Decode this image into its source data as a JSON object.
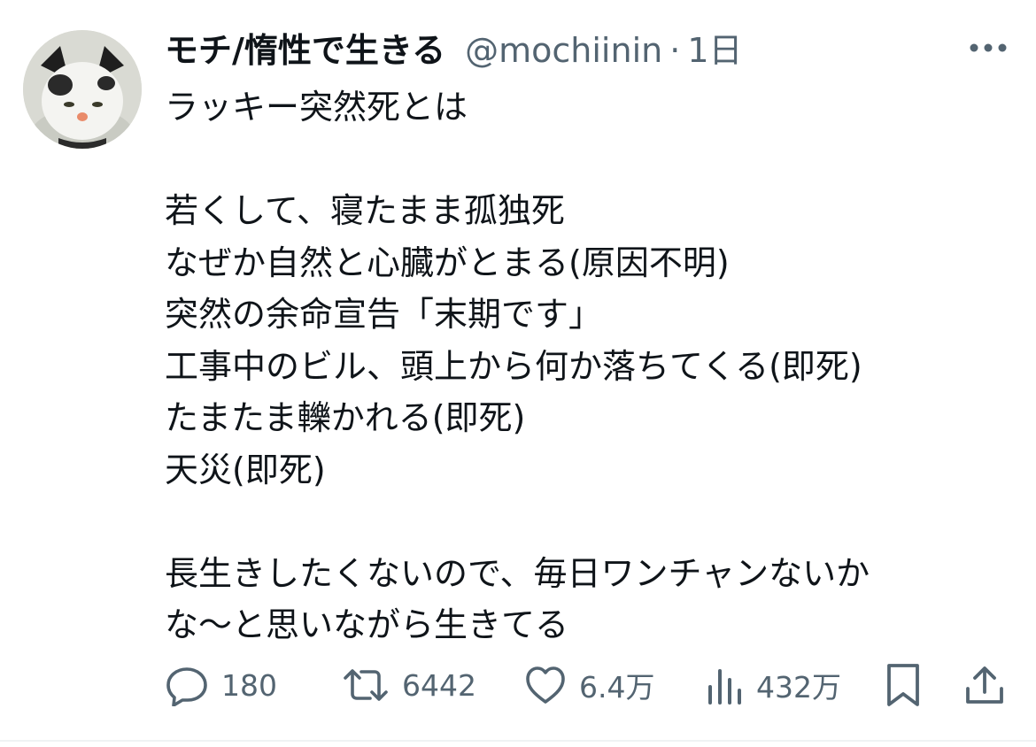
{
  "tweet": {
    "author": {
      "display_name": "モチ/惰性で生きる",
      "handle": "@mochiinin",
      "separator": "·",
      "time": "1日"
    },
    "lines": [
      "ラッキー突然死とは",
      "",
      "若くして、寝たまま孤独死",
      "なぜか自然と心臓がとまる(原因不明)",
      "突然の余命宣告「末期です」",
      "工事中のビル、頭上から何か落ちてくる(即死)",
      "たまたま轢かれる(即死)",
      "天災(即死)",
      "",
      "長生きしたくないので、毎日ワンチャンないか",
      "な〜と思いながら生きてる"
    ],
    "actions": {
      "reply": {
        "icon": "reply-icon",
        "count": "180"
      },
      "retweet": {
        "icon": "retweet-icon",
        "count": "6442"
      },
      "like": {
        "icon": "heart-icon",
        "count": "6.4万"
      },
      "views": {
        "icon": "views-icon",
        "count": "432万"
      },
      "bookmark": {
        "icon": "bookmark-icon"
      },
      "share": {
        "icon": "share-icon"
      }
    }
  },
  "colors": {
    "text_primary": "#0f1419",
    "text_secondary": "#536471",
    "divider": "#eff3f4"
  }
}
